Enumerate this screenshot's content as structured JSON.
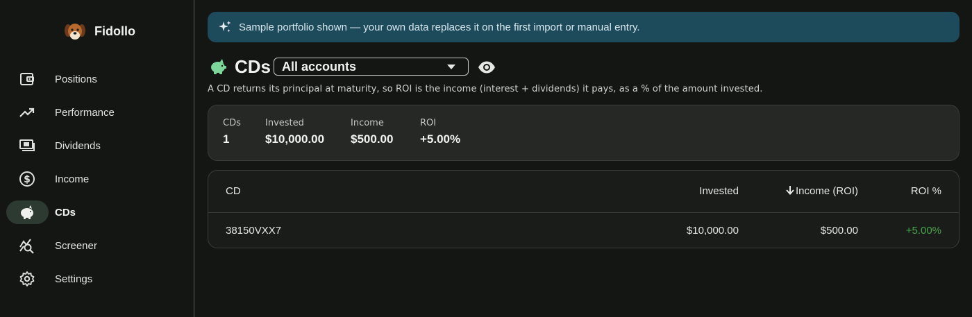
{
  "app": {
    "name": "Fidollo"
  },
  "sidebar": {
    "items": [
      {
        "label": "Positions",
        "icon": "wallet-icon",
        "active": false
      },
      {
        "label": "Performance",
        "icon": "trending-up-icon",
        "active": false
      },
      {
        "label": "Dividends",
        "icon": "cash-icon",
        "active": false
      },
      {
        "label": "Income",
        "icon": "dollar-circle-icon",
        "active": false
      },
      {
        "label": "CDs",
        "icon": "piggy-bank-icon",
        "active": true
      },
      {
        "label": "Screener",
        "icon": "query-stats-icon",
        "active": false
      },
      {
        "label": "Settings",
        "icon": "gear-icon",
        "active": false
      }
    ]
  },
  "banner": {
    "text": "Sample portfolio shown — your own data replaces it on the first import or manual entry.",
    "icon": "sparkle-icon"
  },
  "header": {
    "title": "CDs",
    "account_select": {
      "value": "All accounts"
    }
  },
  "note": "A CD returns its principal at maturity, so ROI is the income (interest + dividends) it pays, as a % of the amount invested.",
  "summary": {
    "cds": {
      "label": "CDs",
      "value": "1"
    },
    "invested": {
      "label": "Invested",
      "value": "$10,000.00"
    },
    "income": {
      "label": "Income",
      "value": "$500.00"
    },
    "roi": {
      "label": "ROI",
      "value": "+5.00%"
    }
  },
  "table": {
    "columns": {
      "cd": "CD",
      "invested": "Invested",
      "income": "Income (ROI)",
      "roi": "ROI %"
    },
    "sorted_by": "income",
    "rows": [
      {
        "cd": "38150VXX7",
        "invested": "$10,000.00",
        "income": "$500.00",
        "roi": "+5.00%"
      }
    ]
  },
  "colors": {
    "accent": "#7dd69a",
    "positive": "#48a34c",
    "banner_bg": "#1e4b5c",
    "active_nav_bg": "#2c3a31"
  }
}
